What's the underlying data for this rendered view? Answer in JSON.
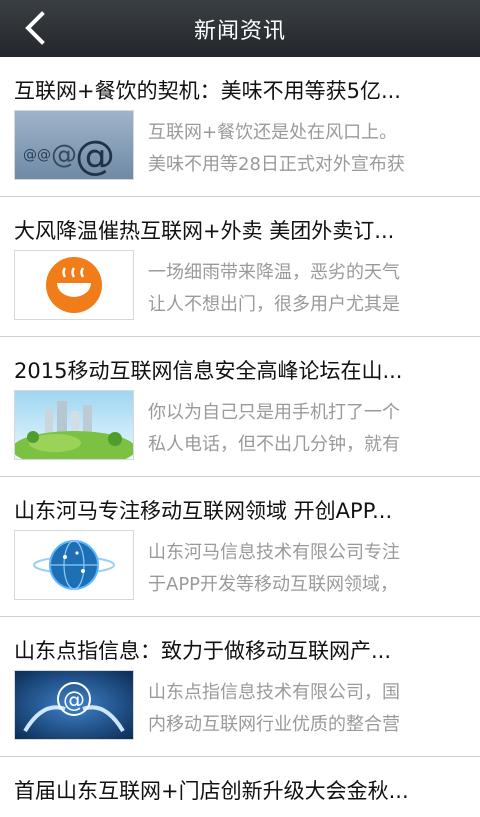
{
  "header": {
    "title": "新闻资讯",
    "back_icon": "chevron-left-icon"
  },
  "news": [
    {
      "title": "互联网+餐饮的契机：美味不用等获5亿...",
      "summary_line1": "互联网+餐饮还是处在风口上。",
      "summary_line2": "美味不用等28日正式对外宣布获",
      "thumb_icon": "email-at-icon"
    },
    {
      "title": "大风降温催热互联网+外卖 美团外卖订...",
      "summary_line1": "一场细雨带来降温，恶劣的天气",
      "summary_line2": "让人不想出门，很多用户尤其是",
      "thumb_icon": "takeout-bowl-icon"
    },
    {
      "title": "2015移动互联网信息安全高峰论坛在山...",
      "summary_line1": "你以为自己只是用手机打了一个",
      "summary_line2": "私人电话，但不出几分钟，就有",
      "thumb_icon": "city-landscape-icon"
    },
    {
      "title": "山东河马专注移动互联网领域 开创APP...",
      "summary_line1": "山东河马信息技术有限公司专注",
      "summary_line2": "于APP开发等移动互联网领域，",
      "thumb_icon": "globe-network-icon"
    },
    {
      "title": "山东点指信息：致力于做移动互联网产...",
      "summary_line1": "山东点指信息技术有限公司，国",
      "summary_line2": "内移动互联网行业优质的整合营",
      "thumb_icon": "hands-at-icon"
    },
    {
      "title": "首届山东互联网+门店创新升级大会金秋..."
    }
  ]
}
